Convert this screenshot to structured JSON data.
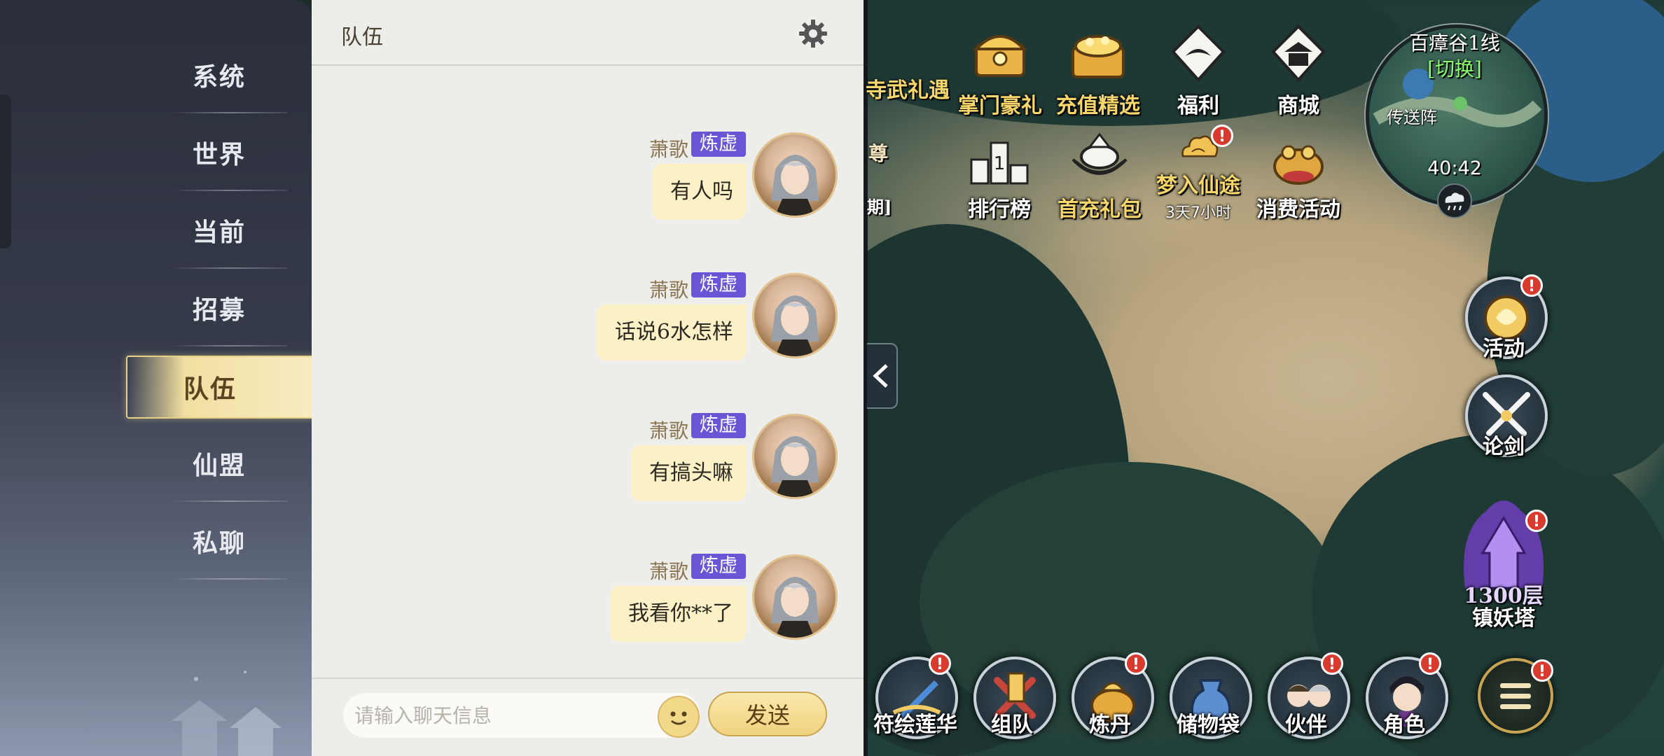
{
  "sidebar": {
    "items": [
      {
        "label": "系统",
        "active": false
      },
      {
        "label": "世界",
        "active": false
      },
      {
        "label": "当前",
        "active": false
      },
      {
        "label": "招募",
        "active": false
      },
      {
        "label": "队伍",
        "active": true
      },
      {
        "label": "仙盟",
        "active": false
      },
      {
        "label": "私聊",
        "active": false
      }
    ]
  },
  "chat": {
    "title": "队伍",
    "messages": [
      {
        "sender": "萧歌",
        "rank": "炼虚",
        "text": "有人吗"
      },
      {
        "sender": "萧歌",
        "rank": "炼虚",
        "text": "话说6水怎样"
      },
      {
        "sender": "萧歌",
        "rank": "炼虚",
        "text": "有搞头嘛"
      },
      {
        "sender": "萧歌",
        "rank": "炼虚",
        "text": "我看你**了"
      }
    ],
    "input_placeholder": "请输入聊天信息",
    "send_label": "发送"
  },
  "game": {
    "partial_left_top": "寺武礼遇",
    "partial_left_mid": "尊",
    "partial_left_low": "期]",
    "top_row": [
      {
        "label": "掌门豪礼",
        "icon": "chest-icon",
        "gold": true
      },
      {
        "label": "充值精选",
        "icon": "treasure-icon",
        "gold": true
      },
      {
        "label": "福利",
        "icon": "gift-icon",
        "gold": false
      },
      {
        "label": "商城",
        "icon": "shop-icon",
        "gold": false
      }
    ],
    "second_row": [
      {
        "label": "排行榜",
        "icon": "ranking-icon",
        "gold": false,
        "sub": ""
      },
      {
        "label": "首充礼包",
        "icon": "ingot-icon",
        "gold": true,
        "sub": ""
      },
      {
        "label": "梦入仙途",
        "icon": "cloud-icon",
        "gold": true,
        "sub": "3天7小时"
      },
      {
        "label": "消费活动",
        "icon": "toad-icon",
        "gold": false,
        "sub": ""
      }
    ],
    "minimap": {
      "name": "百瘴谷1线",
      "switch_label": "[切换]",
      "portal": "传送阵",
      "time": "40:42"
    },
    "side": [
      {
        "label": "活动",
        "icon": "activity-icon"
      },
      {
        "label": "论剑",
        "icon": "crossed-swords-icon"
      }
    ],
    "tower": {
      "floor": "1300层",
      "name": "镇妖塔"
    },
    "bottom": [
      {
        "label": "符绘莲华",
        "icon": "lotus-icon",
        "alert": true
      },
      {
        "label": "组队",
        "icon": "team-icon",
        "alert": false
      },
      {
        "label": "炼丹",
        "icon": "furnace-icon",
        "alert": true
      },
      {
        "label": "储物袋",
        "icon": "bag-icon",
        "alert": false
      },
      {
        "label": "伙伴",
        "icon": "partner-icon",
        "alert": true
      },
      {
        "label": "角色",
        "icon": "character-icon",
        "alert": true
      }
    ],
    "alert_mark": "!",
    "colors": {
      "gold_text": "#f7d76b",
      "badge": "#6a55d6",
      "alert": "#d83a2e"
    }
  }
}
